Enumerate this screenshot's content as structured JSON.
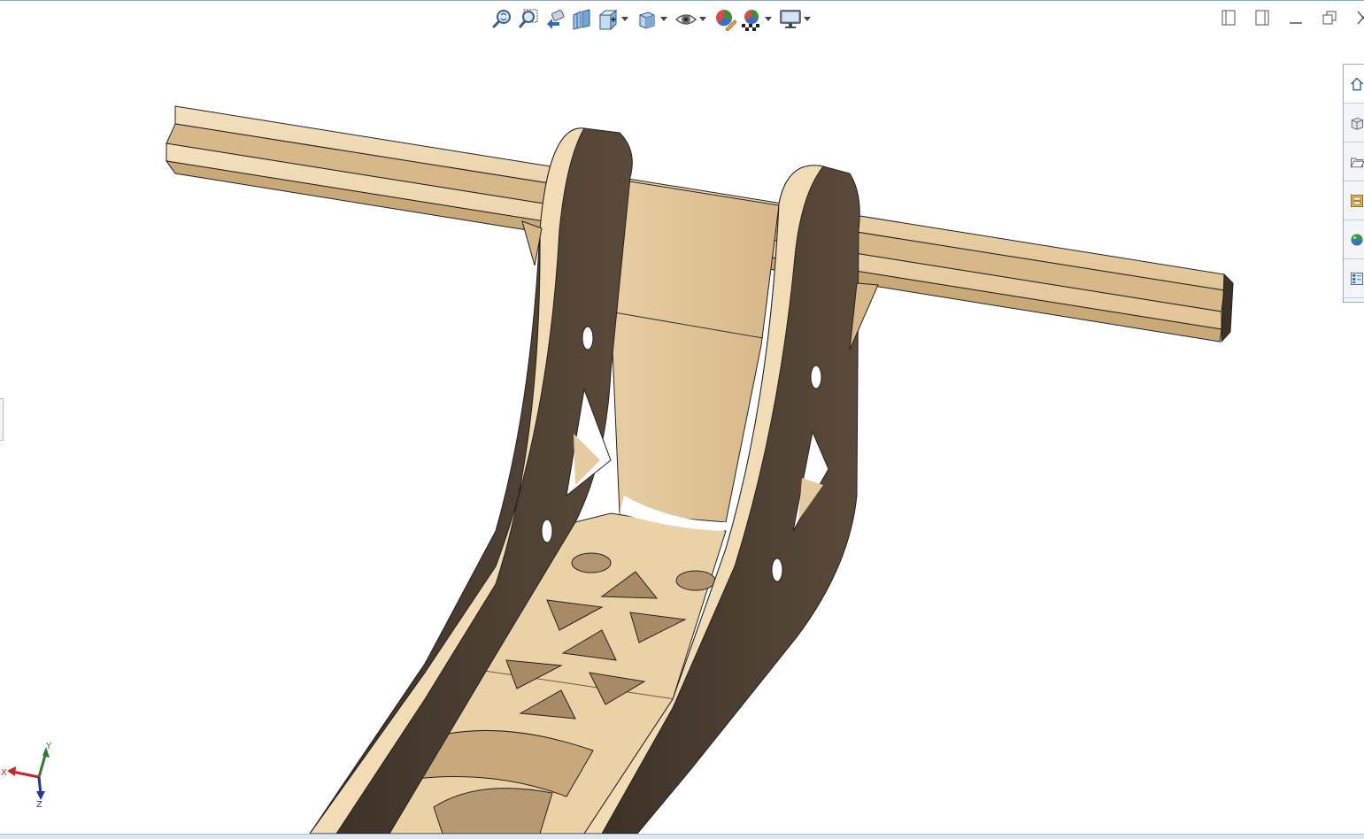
{
  "toolbar": {
    "items": [
      {
        "icon": "zoom-to-fit-icon",
        "dropdown": false
      },
      {
        "icon": "zoom-to-area-icon",
        "dropdown": false
      },
      {
        "icon": "previous-view-icon",
        "dropdown": false
      },
      {
        "icon": "section-view-icon",
        "dropdown": false
      },
      {
        "icon": "view-orientation-icon",
        "dropdown": true
      },
      {
        "icon": "display-style-icon",
        "dropdown": true
      },
      {
        "icon": "hide-show-items-icon",
        "dropdown": true
      },
      {
        "icon": "edit-appearance-icon",
        "dropdown": false
      },
      {
        "icon": "apply-scene-icon",
        "dropdown": true
      },
      {
        "icon": "view-settings-icon",
        "dropdown": true
      }
    ]
  },
  "window_controls": [
    "tile-left-icon",
    "tile-right-icon",
    "minimize-icon",
    "restore-icon",
    "close-icon"
  ],
  "task_pane": [
    "home-icon",
    "design-library-icon",
    "file-explorer-icon",
    "view-palette-icon",
    "appearances-icon",
    "custom-properties-icon"
  ],
  "triad": {
    "x": "X",
    "y": "Y",
    "z": "Z"
  },
  "colors": {
    "wood_light": "#ecd3a5",
    "wood_mid": "#d8b98a",
    "wood_dark": "#4a3c2e",
    "toolbar_accent": "#2d6db4"
  }
}
